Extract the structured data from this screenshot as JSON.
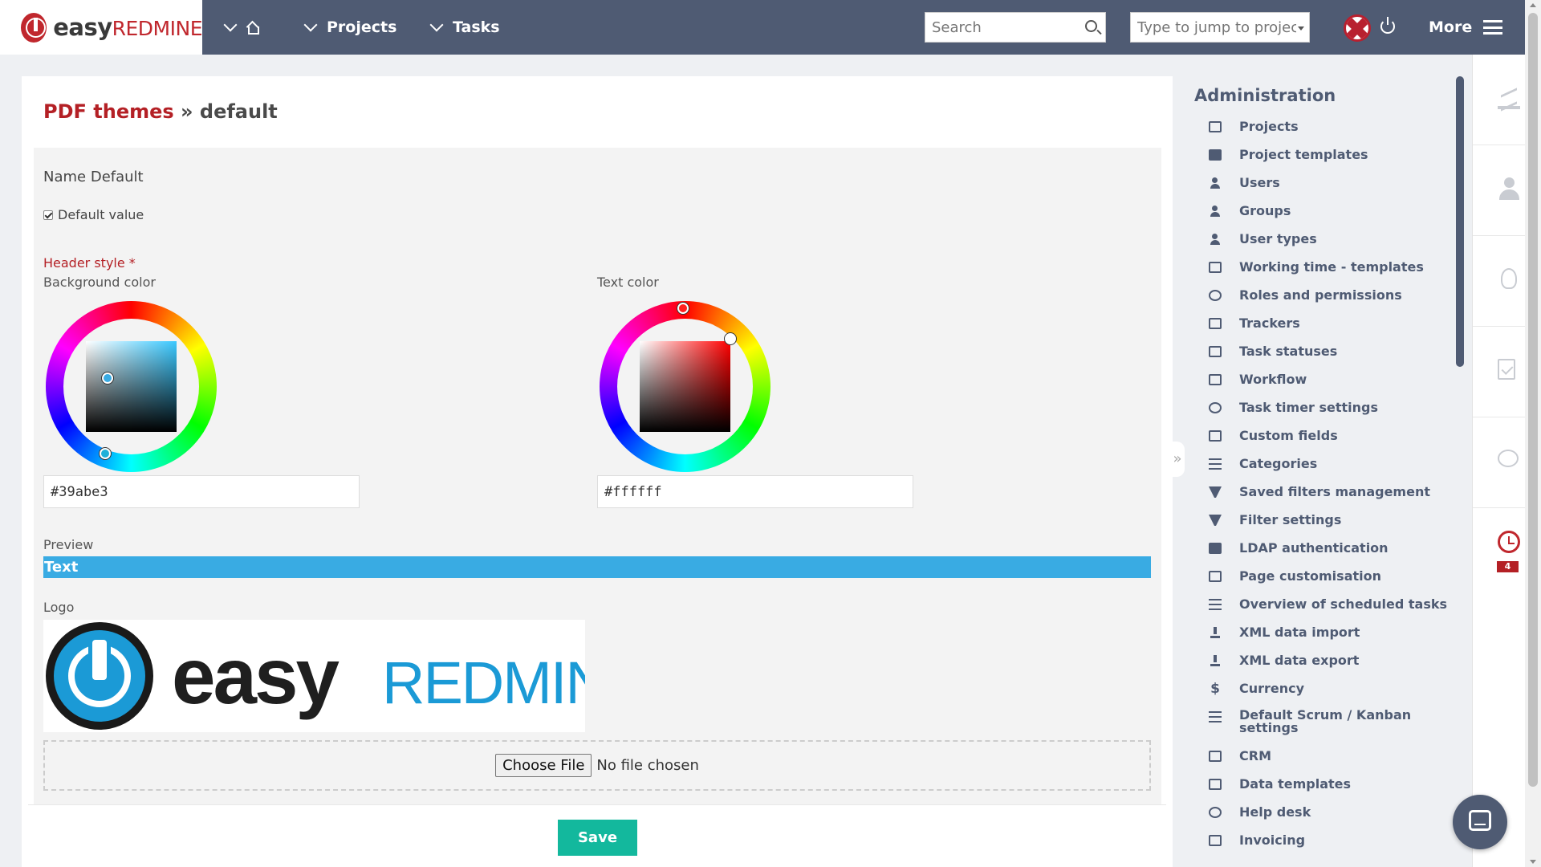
{
  "header": {
    "logo_prefix": "easy",
    "logo_suffix": "REDMINE",
    "nav": {
      "projects": "Projects",
      "tasks": "Tasks"
    },
    "search_placeholder": "Search",
    "jump_placeholder": "Type to jump to project",
    "more_label": "More"
  },
  "page": {
    "breadcrumb": "PDF themes",
    "separator": " » ",
    "title": "default"
  },
  "form": {
    "name_label": "Name",
    "name_value": "Default",
    "default_checkbox_label": "Default value",
    "default_checked": true,
    "header_style_label": "Header style *",
    "background_color_label": "Background color",
    "background_color_value": "#39abe3",
    "text_color_label": "Text color",
    "text_color_value": "#ffffff",
    "preview_label": "Preview",
    "preview_text": "Text",
    "logo_label": "Logo",
    "logo_image_prefix": "easy",
    "logo_image_suffix": "REDMINE",
    "choose_file_label": "Choose File",
    "file_status": "No file chosen",
    "save_label": "Save"
  },
  "admin": {
    "title": "Administration",
    "items": [
      {
        "label": "Projects",
        "icon": "folder-icon"
      },
      {
        "label": "Project templates",
        "icon": "folder-filled-icon"
      },
      {
        "label": "Users",
        "icon": "user-icon"
      },
      {
        "label": "Groups",
        "icon": "group-icon"
      },
      {
        "label": "User types",
        "icon": "user-types-icon"
      },
      {
        "label": "Working time - templates",
        "icon": "calendar-icon"
      },
      {
        "label": "Roles and permissions",
        "icon": "key-icon"
      },
      {
        "label": "Trackers",
        "icon": "document-icon"
      },
      {
        "label": "Task statuses",
        "icon": "clipboard-icon"
      },
      {
        "label": "Workflow",
        "icon": "workflow-icon"
      },
      {
        "label": "Task timer settings",
        "icon": "history-icon"
      },
      {
        "label": "Custom fields",
        "icon": "edit-icon"
      },
      {
        "label": "Categories",
        "icon": "categories-icon"
      },
      {
        "label": "Saved filters management",
        "icon": "filter-icon"
      },
      {
        "label": "Filter settings",
        "icon": "filter-icon"
      },
      {
        "label": "LDAP authentication",
        "icon": "server-icon"
      },
      {
        "label": "Page customisation",
        "icon": "page-icon"
      },
      {
        "label": "Overview of scheduled tasks",
        "icon": "stack-icon"
      },
      {
        "label": "XML data import",
        "icon": "download-icon"
      },
      {
        "label": "XML data export",
        "icon": "upload-icon"
      },
      {
        "label": "Currency",
        "icon": "dollar-icon"
      },
      {
        "label": "Default Scrum / Kanban settings",
        "icon": "list-icon"
      },
      {
        "label": "CRM",
        "icon": "crm-icon"
      },
      {
        "label": "Data templates",
        "icon": "copy-icon"
      },
      {
        "label": "Help desk",
        "icon": "chat-icon"
      },
      {
        "label": "Invoicing",
        "icon": "invoice-icon"
      }
    ]
  },
  "rail": {
    "timer_badge": "4"
  },
  "colors": {
    "topbar": "#4f5b73",
    "brand_red": "#b42025",
    "accent_teal": "#13b89d",
    "preview_bg": "#39abe3"
  }
}
